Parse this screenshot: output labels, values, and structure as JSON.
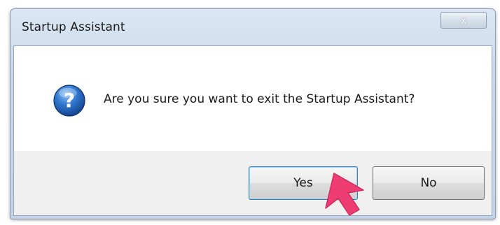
{
  "window": {
    "title": "Startup Assistant",
    "close_glyph": "x"
  },
  "dialog": {
    "icon": "question-icon",
    "message": "Are you sure you want to exit the Startup Assistant?"
  },
  "buttons": {
    "yes_label": "Yes",
    "no_label": "No"
  },
  "colors": {
    "titlebar": "#c9d9ea",
    "content_bg": "#ffffff",
    "button_area_bg": "#f0f0f0",
    "icon_blue": "#1f5fb3",
    "focus_border": "#3c7fb1",
    "cursor_pink": "#ee3d73"
  }
}
